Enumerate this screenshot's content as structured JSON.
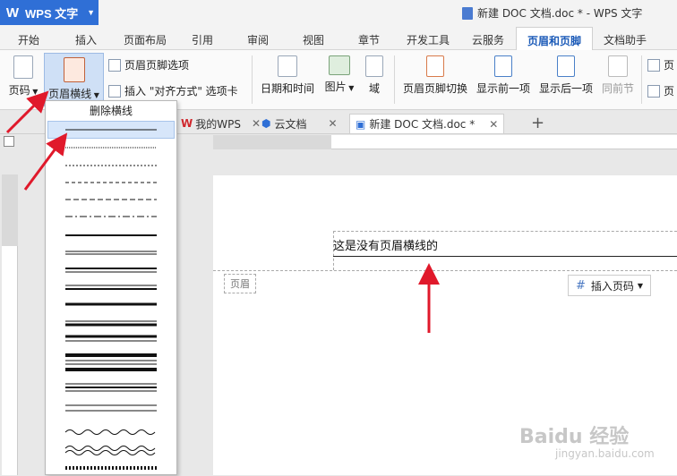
{
  "app": {
    "name": "WPS 文字",
    "window_title": "新建 DOC 文档.doc * - WPS 文字"
  },
  "menu": {
    "tabs": [
      "开始",
      "插入",
      "页面布局",
      "引用",
      "审阅",
      "视图",
      "章节",
      "开发工具",
      "云服务",
      "页眉和页脚",
      "文档助手"
    ],
    "active": "页眉和页脚"
  },
  "ribbon": {
    "page_number": "页码",
    "header_line": "页眉横线",
    "header_footer_options": "页眉页脚选项",
    "insert_align_tab": "插入 \"对齐方式\" 选项卡",
    "date_time": "日期和时间",
    "picture": "图片",
    "field": "域",
    "switch": "页眉页脚切换",
    "show_prev": "显示前一项",
    "show_next": "显示后一项",
    "same_as_prev": "同前节",
    "cut1": "页",
    "cut2": "页"
  },
  "doc_tabs": {
    "my_wps": "我的WPS",
    "cloud": "云文档",
    "current": "新建 DOC 文档.doc *"
  },
  "dropdown": {
    "delete_line": "删除横线"
  },
  "document": {
    "header_text": "这是没有页眉横线的",
    "header_label": "页眉",
    "insert_page_number": "插入页码"
  },
  "colors": {
    "wps_blue": "#2f6fd6",
    "accent_text": "#1c5bb8",
    "arrow_red": "#e0192b"
  },
  "watermark": {
    "logo": "Baidu 经验",
    "url": "jingyan.baidu.com"
  }
}
